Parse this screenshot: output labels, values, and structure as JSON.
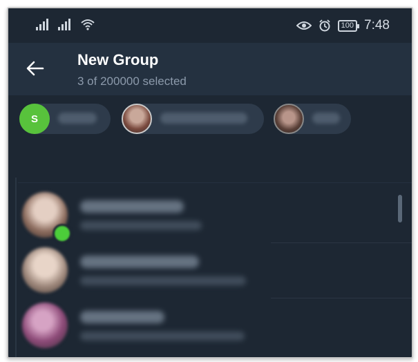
{
  "status": {
    "time": "7:48",
    "battery": "100",
    "icons": [
      "signal-icon",
      "signal-icon",
      "wifi-icon",
      "eye-icon",
      "alarm-icon",
      "battery-icon"
    ]
  },
  "header": {
    "title": "New Group",
    "subtitle": "3 of 200000 selected",
    "back_icon": "arrow-left-icon"
  },
  "chips": [
    {
      "avatar_letter": "S",
      "avatar_color": "#58c23c"
    },
    {
      "avatar_color": "#7a4a3e"
    },
    {
      "avatar_color": "#5a4038"
    }
  ],
  "contacts": [
    {
      "avatar_color": "#8a6a5c",
      "online": true
    },
    {
      "avatar_color": "#9a8478",
      "online": false
    },
    {
      "avatar_color": "#8d4a78",
      "online": false
    }
  ],
  "colors": {
    "background": "#1d2733",
    "header": "#243140",
    "chip": "#2e3b4b",
    "online": "#4ccd3a"
  }
}
